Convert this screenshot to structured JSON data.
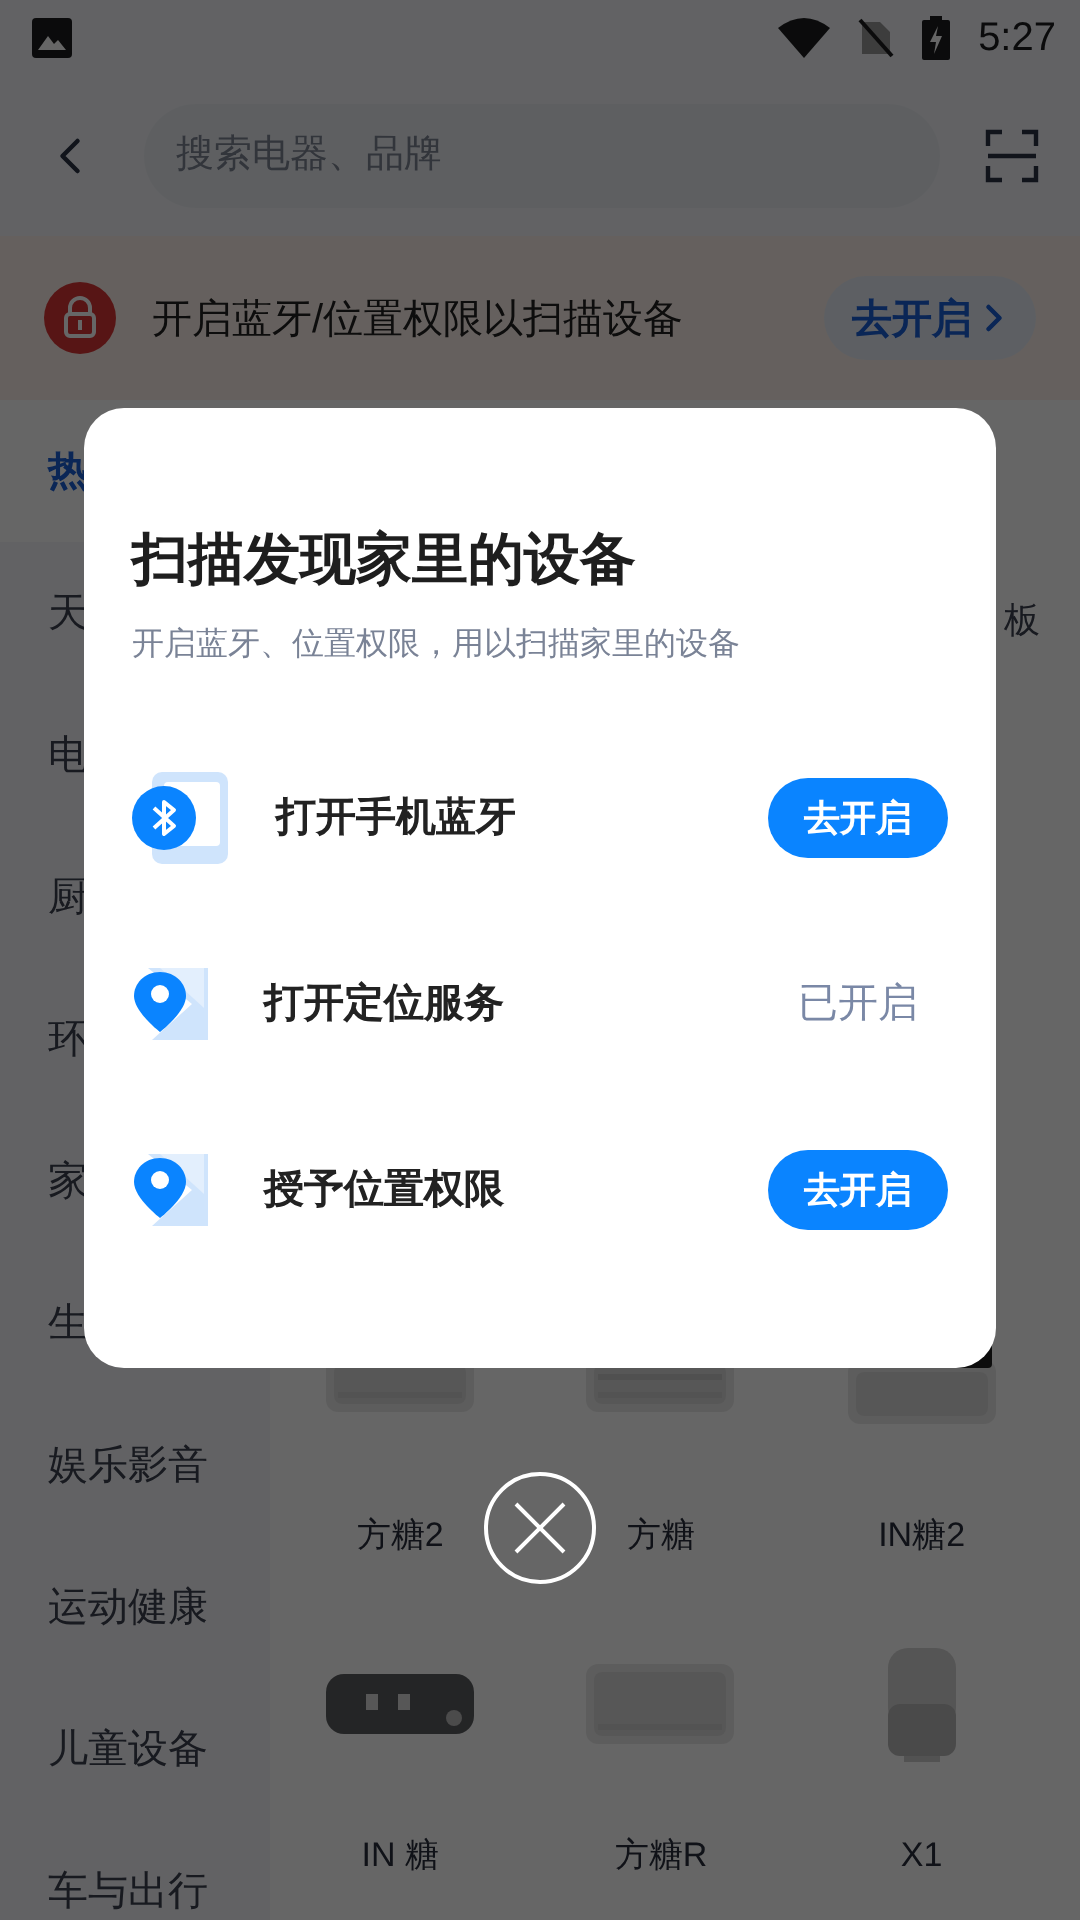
{
  "status_bar": {
    "time": "5:27"
  },
  "header": {
    "search": {
      "placeholder": "搜索电器、品牌"
    }
  },
  "banner": {
    "text": "开启蓝牙/位置权限以扫描设备",
    "button": "去开启"
  },
  "sidebar": {
    "items": [
      {
        "label": "热",
        "selected": true
      },
      {
        "label": "天",
        "selected": false
      },
      {
        "label": "电",
        "selected": false
      },
      {
        "label": "厨",
        "selected": false
      },
      {
        "label": "环",
        "selected": false
      },
      {
        "label": "家",
        "selected": false
      },
      {
        "label": "生",
        "selected": false
      },
      {
        "label": "娱乐影音",
        "selected": false
      },
      {
        "label": "运动健康",
        "selected": false
      },
      {
        "label": "儿童设备",
        "selected": false
      },
      {
        "label": "车与出行",
        "selected": false
      }
    ]
  },
  "products": {
    "cut_label": "板",
    "items": [
      {
        "name": "方糖2",
        "kind": "picture"
      },
      {
        "name": "方糖",
        "kind": "picture"
      },
      {
        "name": "IN糖2",
        "kind": "picture"
      },
      {
        "name": "IN 糖",
        "kind": "picture"
      },
      {
        "name": "方糖R",
        "kind": "picture"
      },
      {
        "name": "X1",
        "kind": "picture"
      }
    ]
  },
  "dialog": {
    "title": "扫描发现家里的设备",
    "subtitle": "开启蓝牙、位置权限，用以扫描家里的设备",
    "rows": [
      {
        "kind": "bluetooth",
        "label": "打开手机蓝牙",
        "enabled": false,
        "action": "去开启"
      },
      {
        "kind": "location",
        "label": "打开定位服务",
        "enabled": true,
        "action": "已开启"
      },
      {
        "kind": "location",
        "label": "授予位置权限",
        "enabled": false,
        "action": "去开启"
      }
    ]
  }
}
